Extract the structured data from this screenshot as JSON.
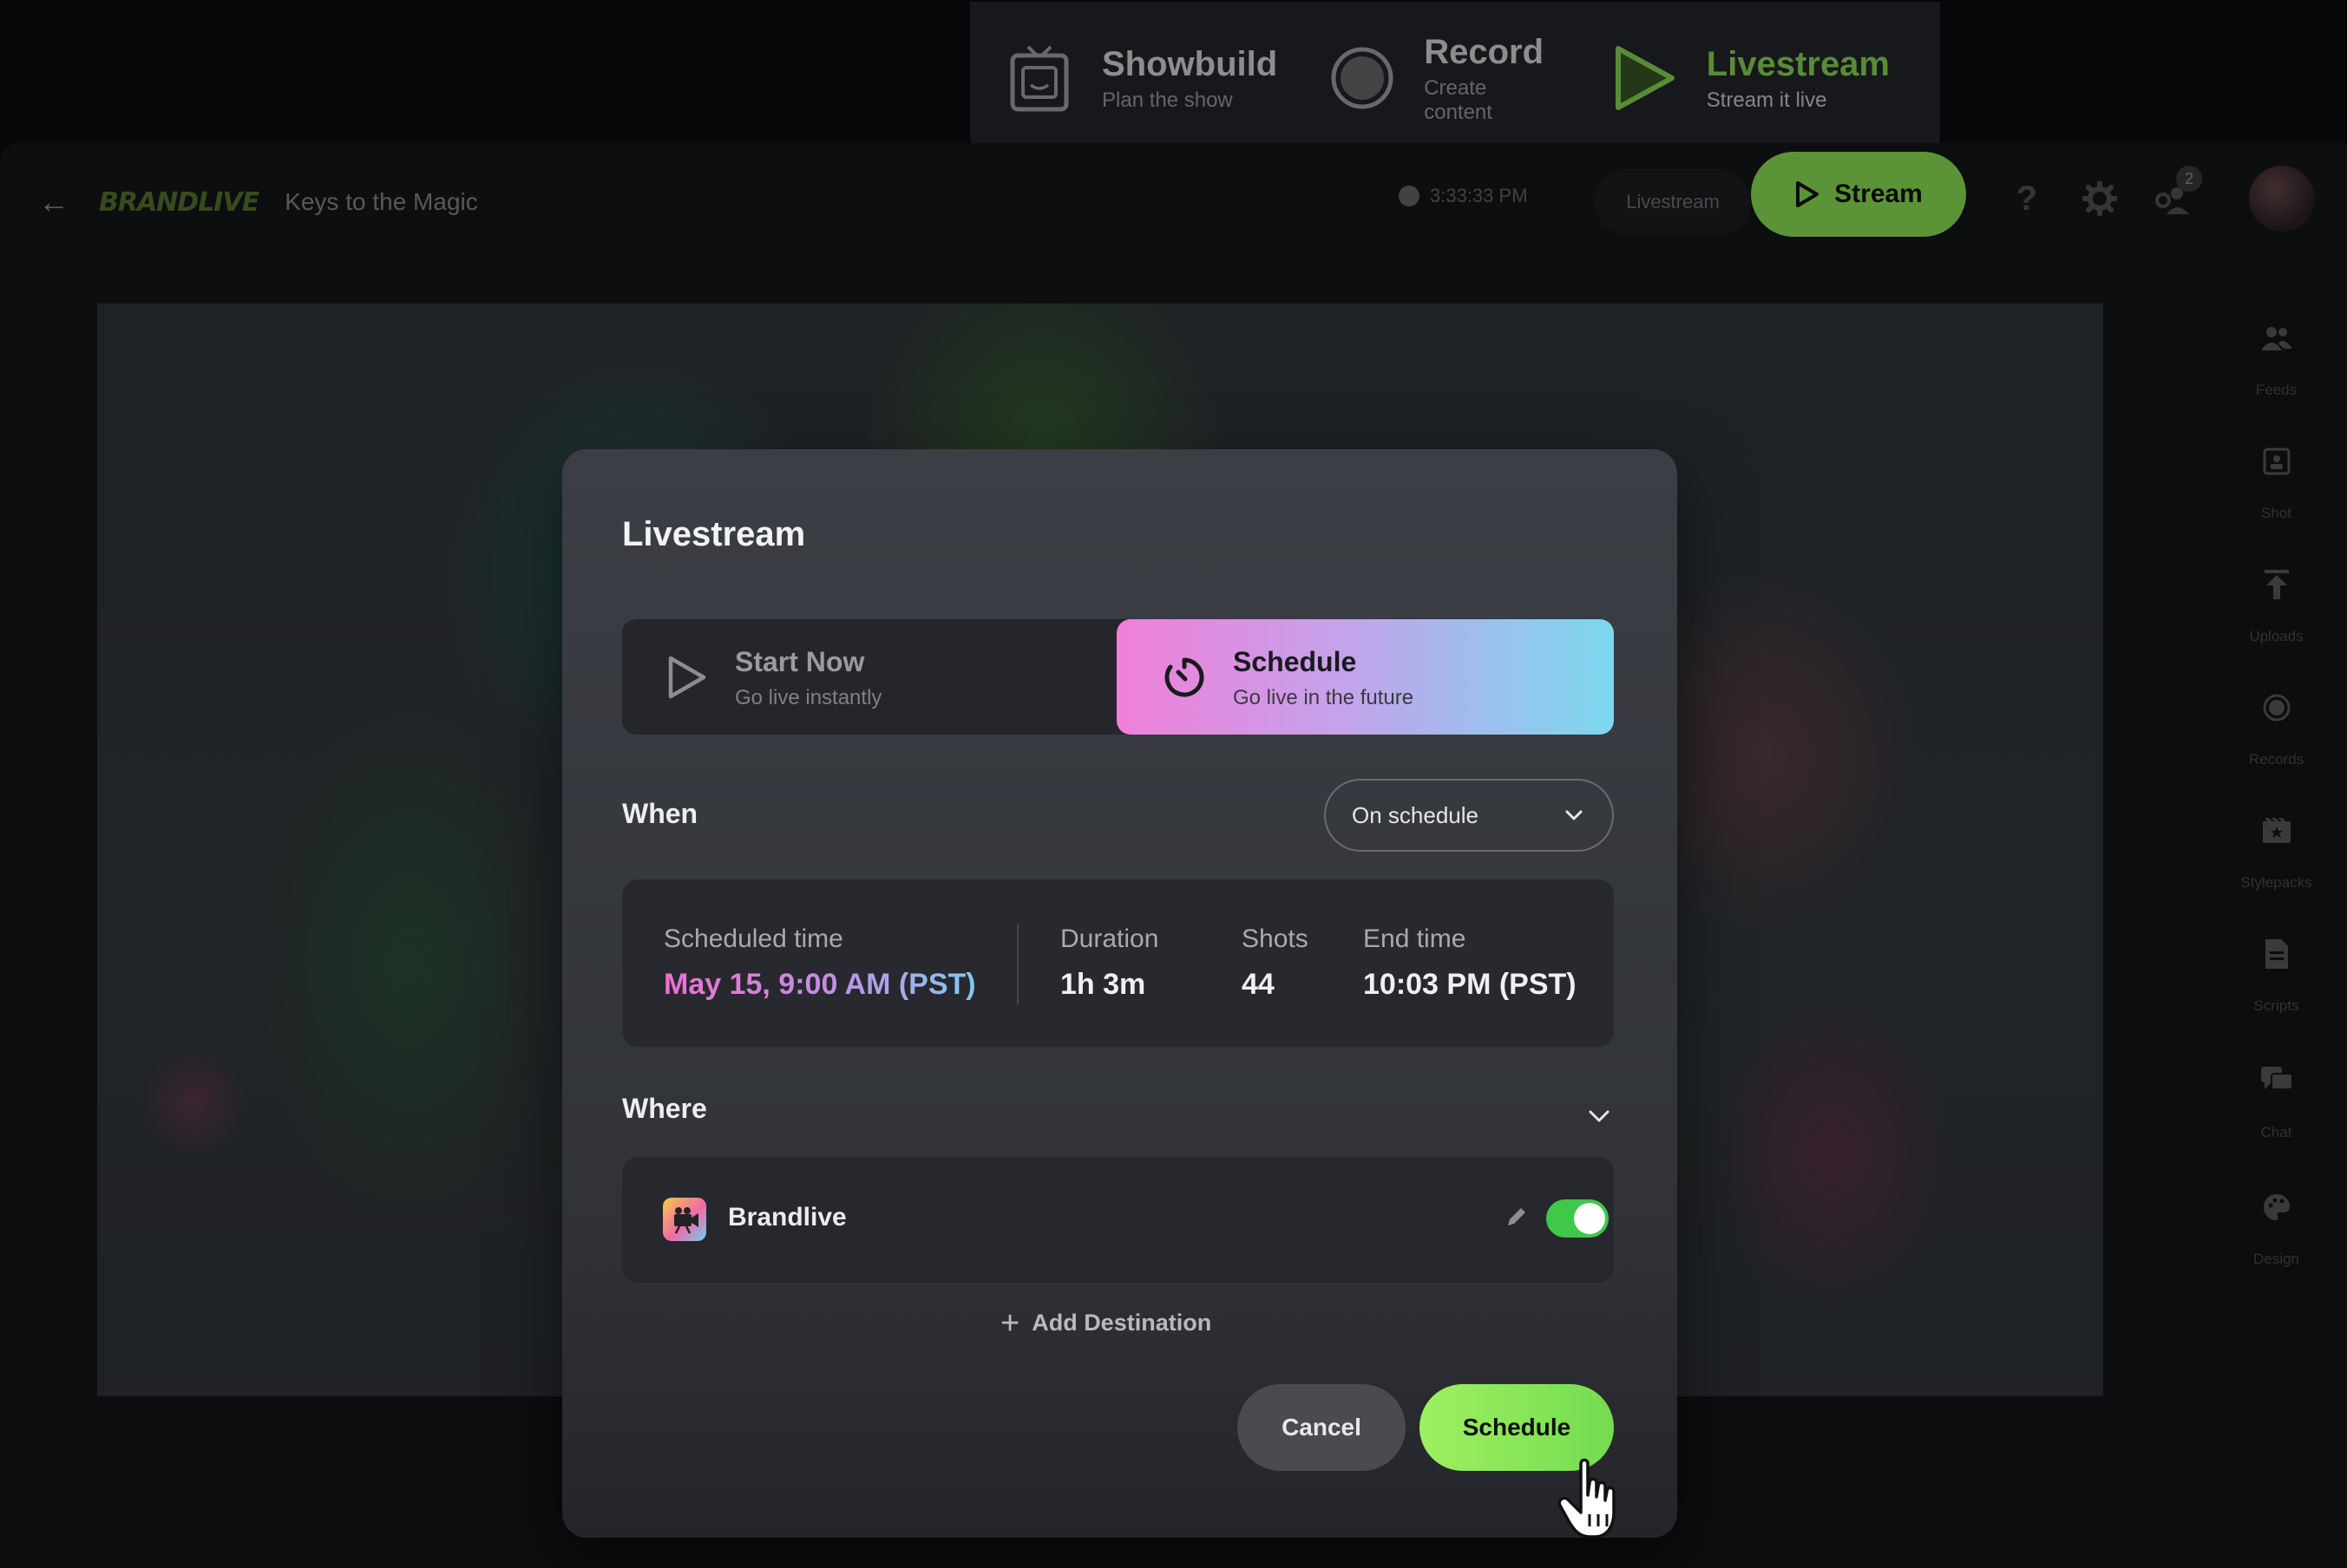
{
  "modes": [
    {
      "title": "Showbuild",
      "subtitle": "Plan the show",
      "icon": "tv-icon"
    },
    {
      "title": "Record",
      "subtitle": "Create content",
      "icon": "record-icon"
    },
    {
      "title": "Livestream",
      "subtitle": "Stream it live",
      "icon": "play-icon",
      "active": true
    }
  ],
  "header": {
    "logo": "BRANDLIVE",
    "project_title": "Keys to the Magic",
    "clock": "3:33:33 PM",
    "mode_label": "Livestream",
    "stream_button": "Stream",
    "notification_count": "2"
  },
  "sidebar": {
    "items": [
      {
        "label": "Feeds",
        "icon": "people-icon"
      },
      {
        "label": "Shot",
        "icon": "shot-icon"
      },
      {
        "label": "Uploads",
        "icon": "upload-icon"
      },
      {
        "label": "Records",
        "icon": "record-icon"
      },
      {
        "label": "Stylepacks",
        "icon": "film-icon"
      },
      {
        "label": "Scripts",
        "icon": "document-icon"
      },
      {
        "label": "Chat",
        "icon": "chat-icon"
      },
      {
        "label": "Design",
        "icon": "palette-icon"
      }
    ]
  },
  "modal": {
    "title": "Livestream",
    "options": {
      "start_now": {
        "title": "Start Now",
        "subtitle": "Go live instantly"
      },
      "schedule": {
        "title": "Schedule",
        "subtitle": "Go live in the future",
        "selected": true
      }
    },
    "when": {
      "label": "When",
      "select_value": "On schedule"
    },
    "schedule_info": {
      "scheduled_time_label": "Scheduled time",
      "scheduled_time_value": "May 15, 9:00 AM (PST)",
      "duration_label": "Duration",
      "duration_value": "1h 3m",
      "shots_label": "Shots",
      "shots_value": "44",
      "end_time_label": "End time",
      "end_time_value": "10:03 PM (PST)"
    },
    "where": {
      "label": "Where",
      "destination_name": "Brandlive",
      "destination_enabled": true,
      "add_destination": "Add Destination"
    },
    "buttons": {
      "cancel": "Cancel",
      "schedule": "Schedule"
    }
  },
  "colors": {
    "accent_green": "#93ee5a",
    "schedule_gradient": [
      "#f07fd9",
      "#7bd8ef"
    ],
    "toggle_on": "#3fc84a"
  }
}
